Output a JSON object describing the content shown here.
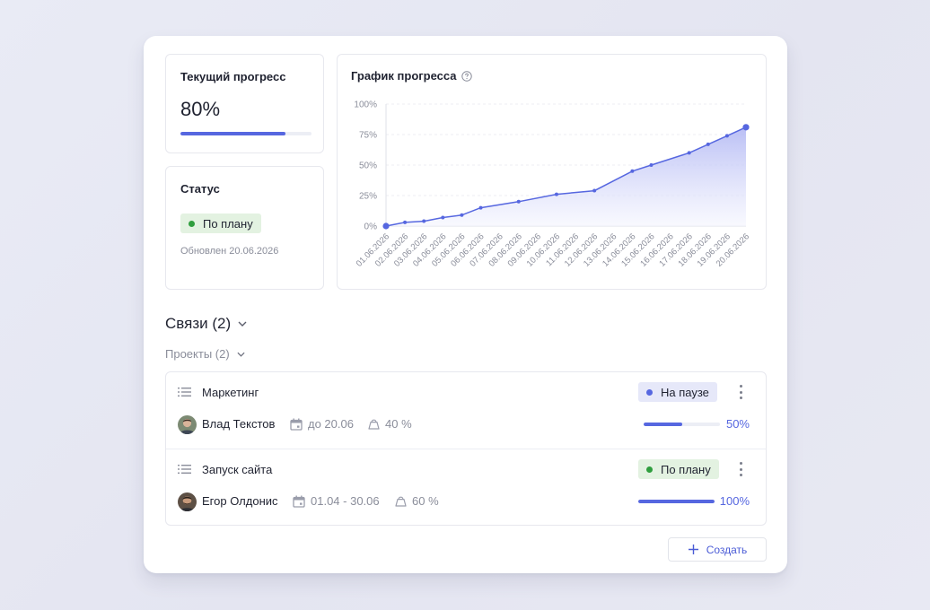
{
  "progress": {
    "title": "Текущий прогресс",
    "value_label": "80%",
    "value": 0.8
  },
  "status": {
    "title": "Статус",
    "badge": "По плану",
    "updated": "Обновлен 20.06.2026"
  },
  "chart_data": {
    "type": "area",
    "title": "График прогресса",
    "xlabel": "",
    "ylabel": "",
    "ylim": [
      0,
      100
    ],
    "y_ticks": [
      "0%",
      "25%",
      "50%",
      "75%",
      "100%"
    ],
    "y_tick_values": [
      0,
      25,
      50,
      75,
      100
    ],
    "grid": true,
    "x": [
      "01.06.2026",
      "02.06.2026",
      "03.06.2026",
      "04.06.2026",
      "05.06.2026",
      "06.06.2026",
      "07.06.2026",
      "08.06.2026",
      "09.06.2026",
      "10.06.2026",
      "11.06.2026",
      "12.06.2026",
      "13.06.2026",
      "14.06.2026",
      "15.06.2026",
      "16.06.2026",
      "17.06.2026",
      "18.06.2026",
      "19.06.2026",
      "20.06.2026"
    ],
    "points": [
      {
        "x": "01.06.2026",
        "y": 0
      },
      {
        "x": "02.06.2026",
        "y": 3
      },
      {
        "x": "03.06.2026",
        "y": 4
      },
      {
        "x": "04.06.2026",
        "y": 7
      },
      {
        "x": "05.06.2026",
        "y": 9
      },
      {
        "x": "06.06.2026",
        "y": 15
      },
      {
        "x": "08.06.2026",
        "y": 20
      },
      {
        "x": "10.06.2026",
        "y": 26
      },
      {
        "x": "12.06.2026",
        "y": 29
      },
      {
        "x": "14.06.2026",
        "y": 45
      },
      {
        "x": "15.06.2026",
        "y": 50
      },
      {
        "x": "17.06.2026",
        "y": 60
      },
      {
        "x": "18.06.2026",
        "y": 67
      },
      {
        "x": "19.06.2026",
        "y": 74
      },
      {
        "x": "20.06.2026",
        "y": 81
      }
    ],
    "colors": {
      "line": "#5667e0",
      "fill_top": "#aeb4f3",
      "fill_bottom": "#f4f5fe"
    }
  },
  "links": {
    "title": "Связи (2)",
    "projects_title": "Проекты (2)",
    "items": [
      {
        "title": "Маркетинг",
        "badge": "На паузе",
        "badge_kind": "blue",
        "person": "Влад Текстов",
        "date": "до 20.06",
        "weight": "40 %",
        "progress": 0.5,
        "progress_label": "50%"
      },
      {
        "title": "Запуск сайта",
        "badge": "По плану",
        "badge_kind": "green",
        "person": "Егор Олдонис",
        "date": "01.04 - 30.06",
        "weight": "60 %",
        "progress": 1.0,
        "progress_label": "100%"
      }
    ]
  },
  "create_label": "Создать",
  "icons": [
    "help-icon",
    "chevron-down-icon",
    "list-icon",
    "kebab-icon",
    "calendar-icon",
    "weight-icon",
    "plus-icon"
  ]
}
